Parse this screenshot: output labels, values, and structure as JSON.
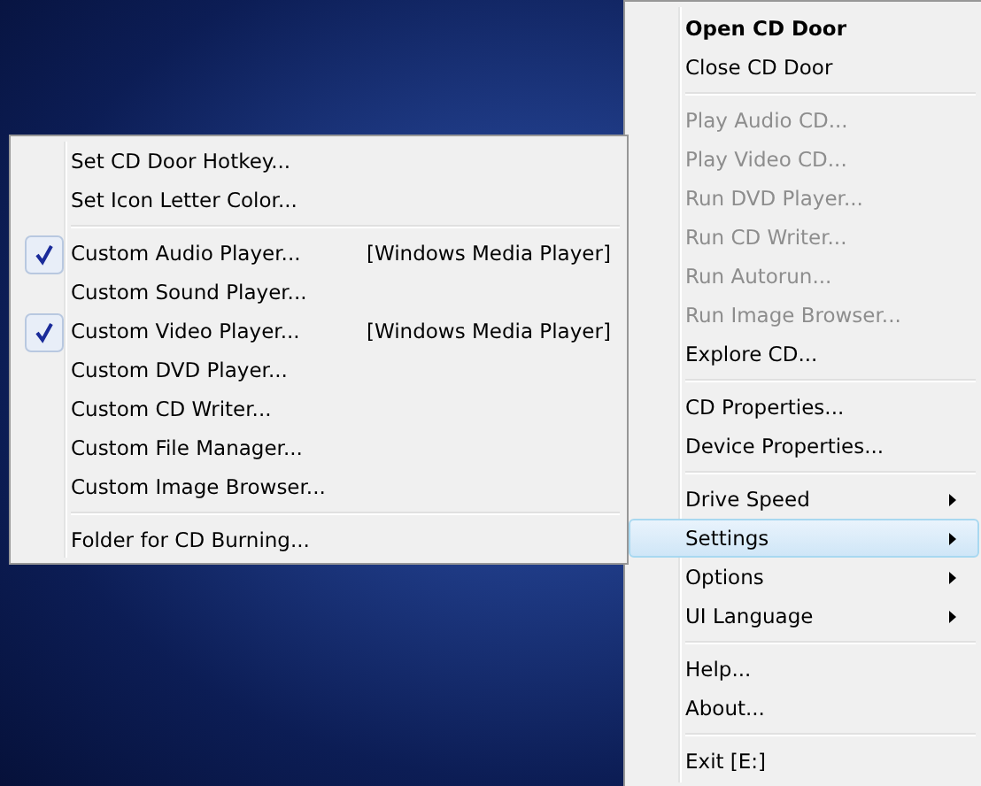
{
  "main_menu": {
    "items": [
      {
        "kind": "item",
        "label": "Open CD Door",
        "default": true,
        "disabled": false,
        "submenu": false,
        "selected": false
      },
      {
        "kind": "item",
        "label": "Close CD Door",
        "default": false,
        "disabled": false,
        "submenu": false,
        "selected": false
      },
      {
        "kind": "separator"
      },
      {
        "kind": "item",
        "label": "Play Audio CD...",
        "default": false,
        "disabled": true,
        "submenu": false,
        "selected": false
      },
      {
        "kind": "item",
        "label": "Play Video CD...",
        "default": false,
        "disabled": true,
        "submenu": false,
        "selected": false
      },
      {
        "kind": "item",
        "label": "Run DVD Player...",
        "default": false,
        "disabled": true,
        "submenu": false,
        "selected": false
      },
      {
        "kind": "item",
        "label": "Run CD Writer...",
        "default": false,
        "disabled": true,
        "submenu": false,
        "selected": false
      },
      {
        "kind": "item",
        "label": "Run Autorun...",
        "default": false,
        "disabled": true,
        "submenu": false,
        "selected": false
      },
      {
        "kind": "item",
        "label": "Run Image Browser...",
        "default": false,
        "disabled": true,
        "submenu": false,
        "selected": false
      },
      {
        "kind": "item",
        "label": "Explore CD...",
        "default": false,
        "disabled": false,
        "submenu": false,
        "selected": false
      },
      {
        "kind": "separator"
      },
      {
        "kind": "item",
        "label": "CD Properties...",
        "default": false,
        "disabled": false,
        "submenu": false,
        "selected": false
      },
      {
        "kind": "item",
        "label": "Device Properties...",
        "default": false,
        "disabled": false,
        "submenu": false,
        "selected": false
      },
      {
        "kind": "separator"
      },
      {
        "kind": "item",
        "label": "Drive Speed",
        "default": false,
        "disabled": false,
        "submenu": true,
        "selected": false
      },
      {
        "kind": "item",
        "label": "Settings",
        "default": false,
        "disabled": false,
        "submenu": true,
        "selected": true
      },
      {
        "kind": "item",
        "label": "Options",
        "default": false,
        "disabled": false,
        "submenu": true,
        "selected": false
      },
      {
        "kind": "item",
        "label": "UI Language",
        "default": false,
        "disabled": false,
        "submenu": true,
        "selected": false
      },
      {
        "kind": "separator"
      },
      {
        "kind": "item",
        "label": "Help...",
        "default": false,
        "disabled": false,
        "submenu": false,
        "selected": false
      },
      {
        "kind": "item",
        "label": "About...",
        "default": false,
        "disabled": false,
        "submenu": false,
        "selected": false
      },
      {
        "kind": "separator"
      },
      {
        "kind": "item",
        "label": "Exit  [E:]",
        "default": false,
        "disabled": false,
        "submenu": false,
        "selected": false
      }
    ]
  },
  "settings_submenu": {
    "items": [
      {
        "kind": "item",
        "label": "Set CD Door Hotkey...",
        "checked": false
      },
      {
        "kind": "item",
        "label": "Set Icon Letter Color...",
        "checked": false
      },
      {
        "kind": "separator"
      },
      {
        "kind": "item",
        "label": "Custom Audio Player...",
        "checked": true,
        "value": "[Windows Media Player]"
      },
      {
        "kind": "item",
        "label": "Custom Sound Player...",
        "checked": false
      },
      {
        "kind": "item",
        "label": "Custom Video Player...",
        "checked": true,
        "value": "[Windows Media Player]"
      },
      {
        "kind": "item",
        "label": "Custom DVD Player...",
        "checked": false
      },
      {
        "kind": "item",
        "label": "Custom CD Writer...",
        "checked": false
      },
      {
        "kind": "item",
        "label": "Custom File Manager...",
        "checked": false
      },
      {
        "kind": "item",
        "label": "Custom Image Browser...",
        "checked": false
      },
      {
        "kind": "separator"
      },
      {
        "kind": "item",
        "label": "Folder for CD Burning...",
        "checked": false
      }
    ]
  }
}
